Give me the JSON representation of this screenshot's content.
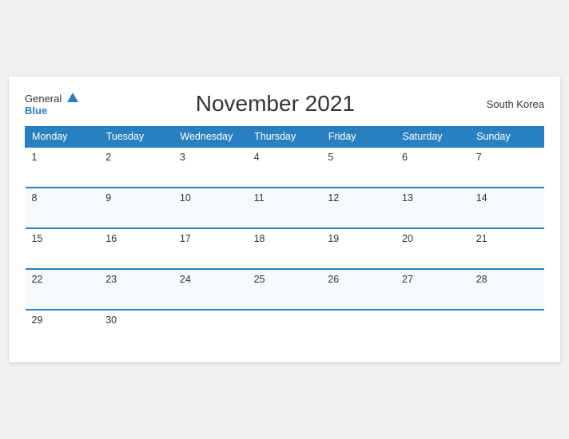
{
  "header": {
    "logo_general": "General",
    "logo_blue": "Blue",
    "title": "November 2021",
    "country": "South Korea"
  },
  "weekdays": [
    "Monday",
    "Tuesday",
    "Wednesday",
    "Thursday",
    "Friday",
    "Saturday",
    "Sunday"
  ],
  "weeks": [
    [
      {
        "day": "1",
        "empty": false
      },
      {
        "day": "2",
        "empty": false
      },
      {
        "day": "3",
        "empty": false
      },
      {
        "day": "4",
        "empty": false
      },
      {
        "day": "5",
        "empty": false
      },
      {
        "day": "6",
        "empty": false
      },
      {
        "day": "7",
        "empty": false
      }
    ],
    [
      {
        "day": "8",
        "empty": false
      },
      {
        "day": "9",
        "empty": false
      },
      {
        "day": "10",
        "empty": false
      },
      {
        "day": "11",
        "empty": false
      },
      {
        "day": "12",
        "empty": false
      },
      {
        "day": "13",
        "empty": false
      },
      {
        "day": "14",
        "empty": false
      }
    ],
    [
      {
        "day": "15",
        "empty": false
      },
      {
        "day": "16",
        "empty": false
      },
      {
        "day": "17",
        "empty": false
      },
      {
        "day": "18",
        "empty": false
      },
      {
        "day": "19",
        "empty": false
      },
      {
        "day": "20",
        "empty": false
      },
      {
        "day": "21",
        "empty": false
      }
    ],
    [
      {
        "day": "22",
        "empty": false
      },
      {
        "day": "23",
        "empty": false
      },
      {
        "day": "24",
        "empty": false
      },
      {
        "day": "25",
        "empty": false
      },
      {
        "day": "26",
        "empty": false
      },
      {
        "day": "27",
        "empty": false
      },
      {
        "day": "28",
        "empty": false
      }
    ],
    [
      {
        "day": "29",
        "empty": false
      },
      {
        "day": "30",
        "empty": false
      },
      {
        "day": "",
        "empty": true
      },
      {
        "day": "",
        "empty": true
      },
      {
        "day": "",
        "empty": true
      },
      {
        "day": "",
        "empty": true
      },
      {
        "day": "",
        "empty": true
      }
    ]
  ]
}
